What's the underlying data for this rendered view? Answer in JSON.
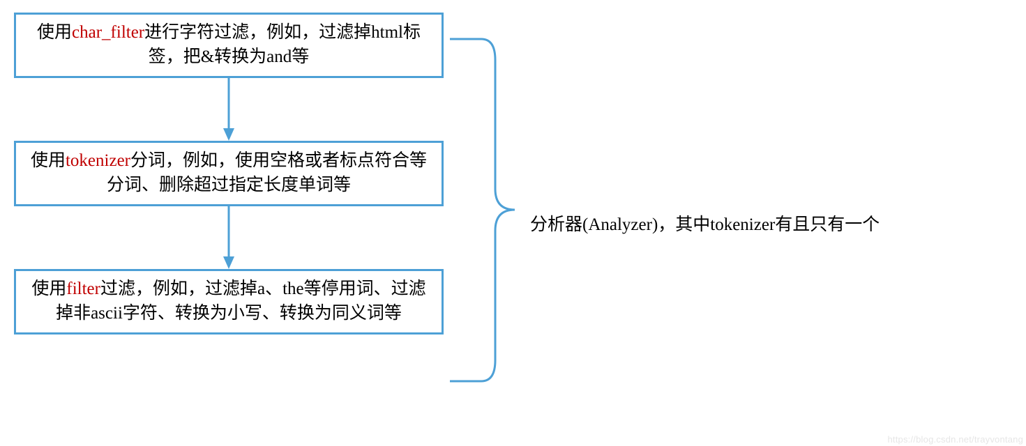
{
  "boxes": [
    {
      "prefix": "使用",
      "keyword": "char_filter",
      "suffix": "进行字符过滤，例如，过滤掉html标签，把&转换为and等"
    },
    {
      "prefix": "使用",
      "keyword": "tokenizer",
      "suffix": "分词，例如，使用空格或者标点符合等分词、删除超过指定长度单词等"
    },
    {
      "prefix": "使用",
      "keyword": "filter",
      "suffix": "过滤，例如，过滤掉a、the等停用词、过滤掉非ascii字符、转换为小写、转换为同义词等"
    }
  ],
  "annotation": "分析器(Analyzer)，其中tokenizer有且只有一个",
  "watermark": "https://blog.csdn.net/trayvontang",
  "colors": {
    "border": "#4da0d6",
    "keyword": "#c00000",
    "text": "#000000"
  }
}
